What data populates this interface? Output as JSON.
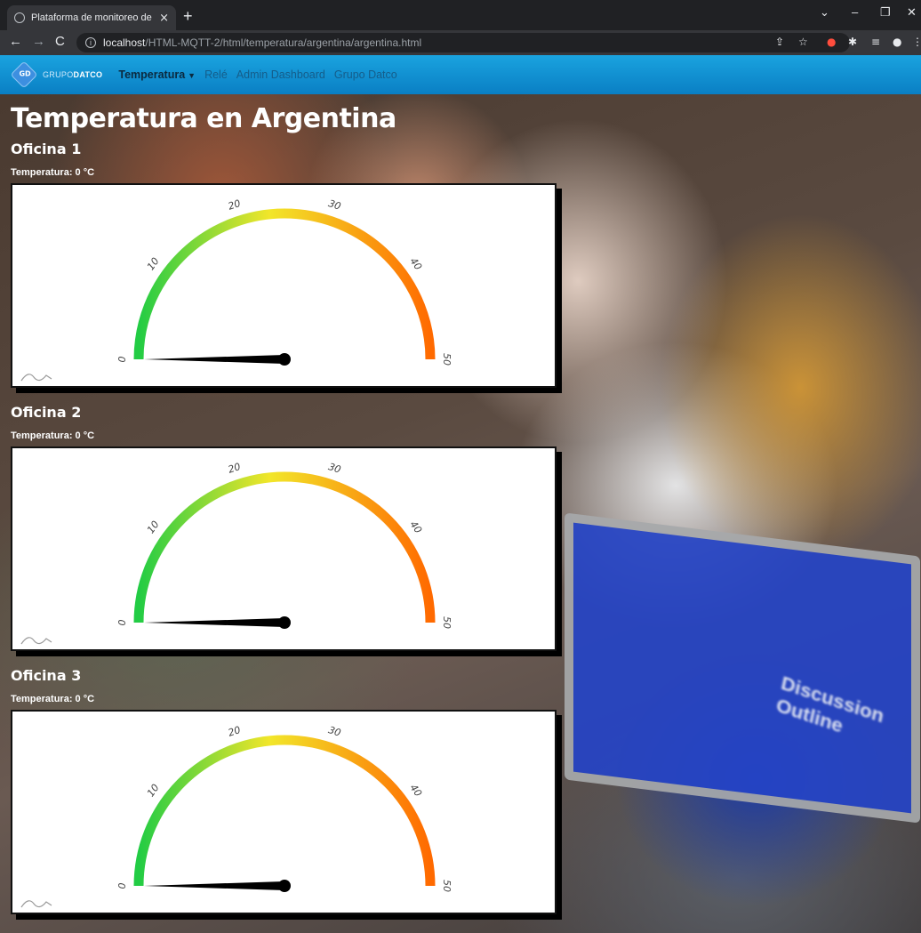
{
  "browser": {
    "tab_title": "Plataforma de monitoreo de MQ",
    "tab_close": "×",
    "new_tab": "+",
    "url_host": "localhost",
    "url_path": "/HTML-MQTT-2/html/temperatura/argentina/argentina.html"
  },
  "navbar": {
    "brand_logo": "GD",
    "brand_prefix": "GRUPO",
    "brand_bold": "DATCO",
    "items": [
      {
        "label": "Temperatura",
        "active": true,
        "dropdown": true
      },
      {
        "label": "Relé"
      },
      {
        "label": "Admin Dashboard"
      },
      {
        "label": "Grupo Datco"
      }
    ]
  },
  "page": {
    "title": "Temperatura en Argentina",
    "offices": [
      {
        "name": "Oficina 1",
        "temp_label": "Temperatura: 0 °C",
        "value": 0
      },
      {
        "name": "Oficina 2",
        "temp_label": "Temperatura: 0 °C",
        "value": 0
      },
      {
        "name": "Oficina 3",
        "temp_label": "Temperatura: 0 °C",
        "value": 0
      }
    ]
  },
  "chart_data": [
    {
      "type": "gauge",
      "min": 0,
      "max": 50,
      "value": 0,
      "ticks": [
        "0",
        "10",
        "20",
        "30",
        "40",
        "50"
      ],
      "band_colors": [
        "#22cc44",
        "#f2e62a",
        "#ff6a00"
      ]
    },
    {
      "type": "gauge",
      "min": 0,
      "max": 50,
      "value": 0,
      "ticks": [
        "0",
        "10",
        "20",
        "30",
        "40",
        "50"
      ],
      "band_colors": [
        "#22cc44",
        "#f2e62a",
        "#ff6a00"
      ]
    },
    {
      "type": "gauge",
      "min": 0,
      "max": 50,
      "value": 0,
      "ticks": [
        "0",
        "10",
        "20",
        "30",
        "40",
        "50"
      ],
      "band_colors": [
        "#22cc44",
        "#f2e62a",
        "#ff6a00"
      ]
    }
  ]
}
